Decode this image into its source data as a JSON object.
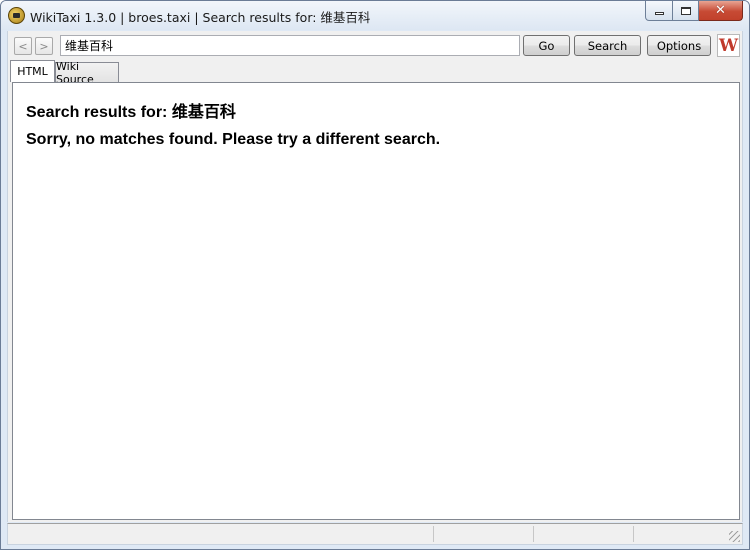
{
  "window": {
    "title": "WikiTaxi 1.3.0 | broes.taxi | Search results for: 维基百科",
    "controls": {
      "minimize_icon": "minimize-icon",
      "maximize_icon": "maximize-icon",
      "close_icon": "close-icon"
    }
  },
  "toolbar": {
    "back_label": "<",
    "forward_label": ">",
    "search_value": "维基百科",
    "go_label": "Go",
    "search_label": "Search",
    "options_label": "Options",
    "logo_label": "W"
  },
  "tabs": [
    {
      "label": "HTML",
      "active": true
    },
    {
      "label": "Wiki Source",
      "active": false
    }
  ],
  "content": {
    "heading": "Search results for: 维基百科",
    "message": "Sorry, no matches found. Please try a different search."
  },
  "colors": {
    "window_frame": "#dfe9f5",
    "close_button": "#c74a34",
    "panel_bg": "#f0f0f0"
  }
}
